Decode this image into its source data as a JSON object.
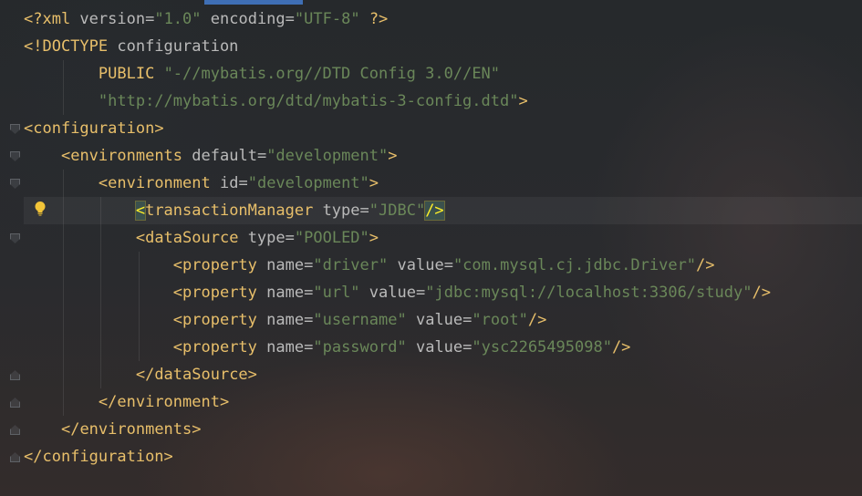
{
  "editor": {
    "lines": [
      [
        [
          "pi",
          "<?xml "
        ],
        [
          "attr",
          "version"
        ],
        [
          "eq",
          "="
        ],
        [
          "str",
          "\"1.0\""
        ],
        [
          "plain",
          " "
        ],
        [
          "attr",
          "encoding"
        ],
        [
          "eq",
          "="
        ],
        [
          "str",
          "\"UTF-8\""
        ],
        [
          "plain",
          " "
        ],
        [
          "pi",
          "?>"
        ]
      ],
      [
        [
          "bracket",
          "<!DOCTYPE "
        ],
        [
          "plain",
          "configuration"
        ]
      ],
      [
        [
          "plain",
          "        "
        ],
        [
          "public",
          "PUBLIC"
        ],
        [
          "plain",
          " "
        ],
        [
          "str",
          "\"-//mybatis.org//DTD Config 3.0//EN\""
        ]
      ],
      [
        [
          "plain",
          "        "
        ],
        [
          "str",
          "\"http://mybatis.org/dtd/mybatis-3-config.dtd\""
        ],
        [
          "bracket",
          ">"
        ]
      ],
      [
        [
          "bracket",
          "<"
        ],
        [
          "tag",
          "configuration"
        ],
        [
          "bracket",
          ">"
        ]
      ],
      [
        [
          "plain",
          "    "
        ],
        [
          "bracket",
          "<"
        ],
        [
          "tag",
          "environments"
        ],
        [
          "plain",
          " "
        ],
        [
          "attr",
          "default"
        ],
        [
          "eq",
          "="
        ],
        [
          "str",
          "\"development\""
        ],
        [
          "bracket",
          ">"
        ]
      ],
      [
        [
          "plain",
          "        "
        ],
        [
          "bracket",
          "<"
        ],
        [
          "tag",
          "environment"
        ],
        [
          "plain",
          " "
        ],
        [
          "attr",
          "id"
        ],
        [
          "eq",
          "="
        ],
        [
          "str",
          "\"development\""
        ],
        [
          "bracket",
          ">"
        ]
      ],
      [
        [
          "plain",
          "            "
        ],
        [
          "hl",
          "<"
        ],
        [
          "tag",
          "transactionManager"
        ],
        [
          "plain",
          " "
        ],
        [
          "attr",
          "type"
        ],
        [
          "eq",
          "="
        ],
        [
          "str",
          "\"JDBC\""
        ],
        [
          "hl",
          "/>"
        ]
      ],
      [
        [
          "plain",
          "            "
        ],
        [
          "bracket",
          "<"
        ],
        [
          "tag",
          "dataSource"
        ],
        [
          "plain",
          " "
        ],
        [
          "attr",
          "type"
        ],
        [
          "eq",
          "="
        ],
        [
          "str",
          "\"POOLED\""
        ],
        [
          "bracket",
          ">"
        ]
      ],
      [
        [
          "plain",
          "                "
        ],
        [
          "bracket",
          "<"
        ],
        [
          "tag",
          "property"
        ],
        [
          "plain",
          " "
        ],
        [
          "attr",
          "name"
        ],
        [
          "eq",
          "="
        ],
        [
          "str",
          "\"driver\""
        ],
        [
          "plain",
          " "
        ],
        [
          "attr",
          "value"
        ],
        [
          "eq",
          "="
        ],
        [
          "str",
          "\"com.mysql.cj.jdbc.Driver\""
        ],
        [
          "bracket",
          "/>"
        ]
      ],
      [
        [
          "plain",
          "                "
        ],
        [
          "bracket",
          "<"
        ],
        [
          "tag",
          "property"
        ],
        [
          "plain",
          " "
        ],
        [
          "attr",
          "name"
        ],
        [
          "eq",
          "="
        ],
        [
          "str",
          "\"url\""
        ],
        [
          "plain",
          " "
        ],
        [
          "attr",
          "value"
        ],
        [
          "eq",
          "="
        ],
        [
          "str",
          "\"jdbc:mysql://localhost:3306/study\""
        ],
        [
          "bracket",
          "/>"
        ]
      ],
      [
        [
          "plain",
          "                "
        ],
        [
          "bracket",
          "<"
        ],
        [
          "tag",
          "property"
        ],
        [
          "plain",
          " "
        ],
        [
          "attr",
          "name"
        ],
        [
          "eq",
          "="
        ],
        [
          "str",
          "\"username\""
        ],
        [
          "plain",
          " "
        ],
        [
          "attr",
          "value"
        ],
        [
          "eq",
          "="
        ],
        [
          "str",
          "\"root\""
        ],
        [
          "bracket",
          "/>"
        ]
      ],
      [
        [
          "plain",
          "                "
        ],
        [
          "bracket",
          "<"
        ],
        [
          "tag",
          "property"
        ],
        [
          "plain",
          " "
        ],
        [
          "attr",
          "name"
        ],
        [
          "eq",
          "="
        ],
        [
          "str",
          "\"password\""
        ],
        [
          "plain",
          " "
        ],
        [
          "attr",
          "value"
        ],
        [
          "eq",
          "="
        ],
        [
          "str",
          "\"ysc2265495098\""
        ],
        [
          "bracket",
          "/>"
        ]
      ],
      [
        [
          "plain",
          "            "
        ],
        [
          "bracket",
          "</"
        ],
        [
          "tag",
          "dataSource"
        ],
        [
          "bracket",
          ">"
        ]
      ],
      [
        [
          "plain",
          "        "
        ],
        [
          "bracket",
          "</"
        ],
        [
          "tag",
          "environment"
        ],
        [
          "bracket",
          ">"
        ]
      ],
      [
        [
          "plain",
          "    "
        ],
        [
          "bracket",
          "</"
        ],
        [
          "tag",
          "environments"
        ],
        [
          "bracket",
          ">"
        ]
      ],
      [
        [
          "bracket",
          "</"
        ],
        [
          "tag",
          "configuration"
        ],
        [
          "bracket",
          ">"
        ]
      ]
    ],
    "current_line": 7,
    "fold_markers": [
      {
        "line": 4,
        "kind": "open"
      },
      {
        "line": 5,
        "kind": "open"
      },
      {
        "line": 6,
        "kind": "open"
      },
      {
        "line": 8,
        "kind": "open"
      },
      {
        "line": 13,
        "kind": "close"
      },
      {
        "line": 14,
        "kind": "close"
      },
      {
        "line": 15,
        "kind": "close"
      },
      {
        "line": 16,
        "kind": "close"
      }
    ],
    "intention_icon": "lightbulb-icon",
    "colors": {
      "tag": "#e8bf6a",
      "attribute": "#bababa",
      "string": "#6a8759",
      "highlight": "#ffef28",
      "scroll_tab": "#3f6fb5"
    }
  }
}
